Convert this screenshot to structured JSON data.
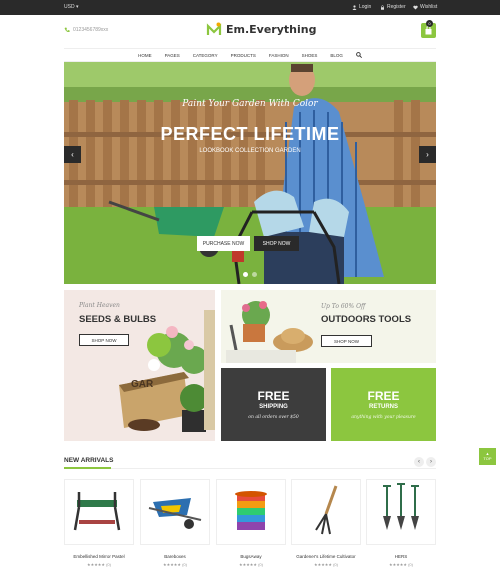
{
  "topbar": {
    "currency": "USD",
    "login": "Login",
    "register": "Register",
    "wishlist": "Wishlist"
  },
  "header": {
    "phone": "0123456789xxx",
    "logo_text": "Em.Everything",
    "cart_count": "0"
  },
  "nav": {
    "items": [
      "HOME",
      "PAGES",
      "CATEGORY",
      "PRODUCTS",
      "FASHION",
      "SHOES",
      "BLOG"
    ]
  },
  "hero": {
    "script": "Paint Your Garden With Color",
    "title": "PERFECT LIFETIME",
    "subtitle": "LOOKBOOK COLLECTION GARDEN",
    "btn_purchase": "PURCHASE NOW",
    "btn_shop": "SHOP NOW"
  },
  "banners": {
    "seeds": {
      "script": "Plant Heaven",
      "title": "SEEDS & BULBS",
      "button": "SHOP NOW",
      "crate": "GAR"
    },
    "tools": {
      "script": "Up To 60% Off",
      "title": "OUTDOORS TOOLS",
      "button": "SHOP NOW"
    },
    "shipping": {
      "title": "FREE",
      "subtitle": "SHIPPING",
      "note": "on all orders over $50",
      "color": "#3d3d3d"
    },
    "returns": {
      "title": "FREE",
      "subtitle": "RETURNS",
      "note": "anything with your pleasure",
      "color": "#8cc63f"
    }
  },
  "new_arrivals": {
    "title": "NEW ARRIVALS",
    "products": [
      {
        "name": "Embellished Mirror Pastel",
        "rating": "★★★★★ (0)"
      },
      {
        "name": "Bareboxes",
        "rating": "★★★★★ (0)"
      },
      {
        "name": "BugsAway",
        "rating": "★★★★★ (0)"
      },
      {
        "name": "Gardener's Lifetime Cultivator",
        "rating": "★★★★★ (0)"
      },
      {
        "name": "HERS",
        "rating": "★★★★★ (0)"
      }
    ]
  },
  "back_to_top": "TOP",
  "colors": {
    "accent": "#8cc63f",
    "dark": "#2a2a2a"
  }
}
